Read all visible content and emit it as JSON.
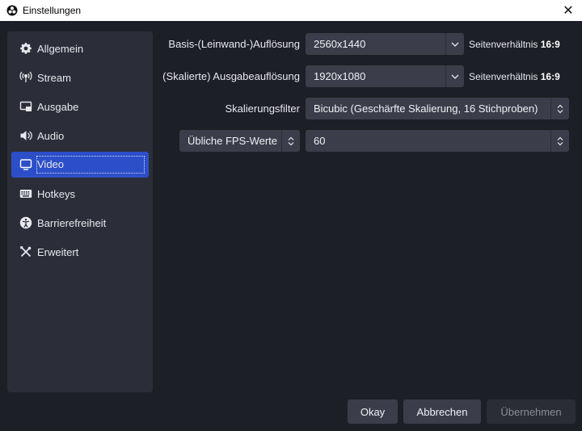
{
  "window": {
    "title": "Einstellungen",
    "close_symbol": "✕"
  },
  "sidebar": {
    "items": [
      {
        "label": "Allgemein",
        "icon": "gear-icon"
      },
      {
        "label": "Stream",
        "icon": "broadcast-icon"
      },
      {
        "label": "Ausgabe",
        "icon": "output-icon"
      },
      {
        "label": "Audio",
        "icon": "speaker-icon"
      },
      {
        "label": "Video",
        "icon": "monitor-icon",
        "active": true
      },
      {
        "label": "Hotkeys",
        "icon": "keyboard-icon"
      },
      {
        "label": "Barrierefreiheit",
        "icon": "accessibility-icon"
      },
      {
        "label": "Erweitert",
        "icon": "tools-icon"
      }
    ]
  },
  "video": {
    "base_resolution": {
      "label": "Basis-(Leinwand-)Auflösung",
      "value": "2560x1440",
      "aspect_prefix": "Seitenverhältnis",
      "aspect_value": "16:9"
    },
    "output_resolution": {
      "label": "(Skalierte) Ausgabeauflösung",
      "value": "1920x1080",
      "aspect_prefix": "Seitenverhältnis",
      "aspect_value": "16:9"
    },
    "scale_filter": {
      "label": "Skalierungsfilter",
      "value": "Bicubic (Geschärfte Skalierung, 16 Stichproben)"
    },
    "fps": {
      "type_value": "Übliche FPS-Werte",
      "value": "60"
    }
  },
  "buttons": {
    "okay": "Okay",
    "cancel": "Abbrechen",
    "apply": "Übernehmen"
  },
  "colors": {
    "background": "#1d1f26",
    "sidebar": "#2b2e38",
    "accent": "#2c4fc9",
    "control": "#3b3e4a"
  }
}
